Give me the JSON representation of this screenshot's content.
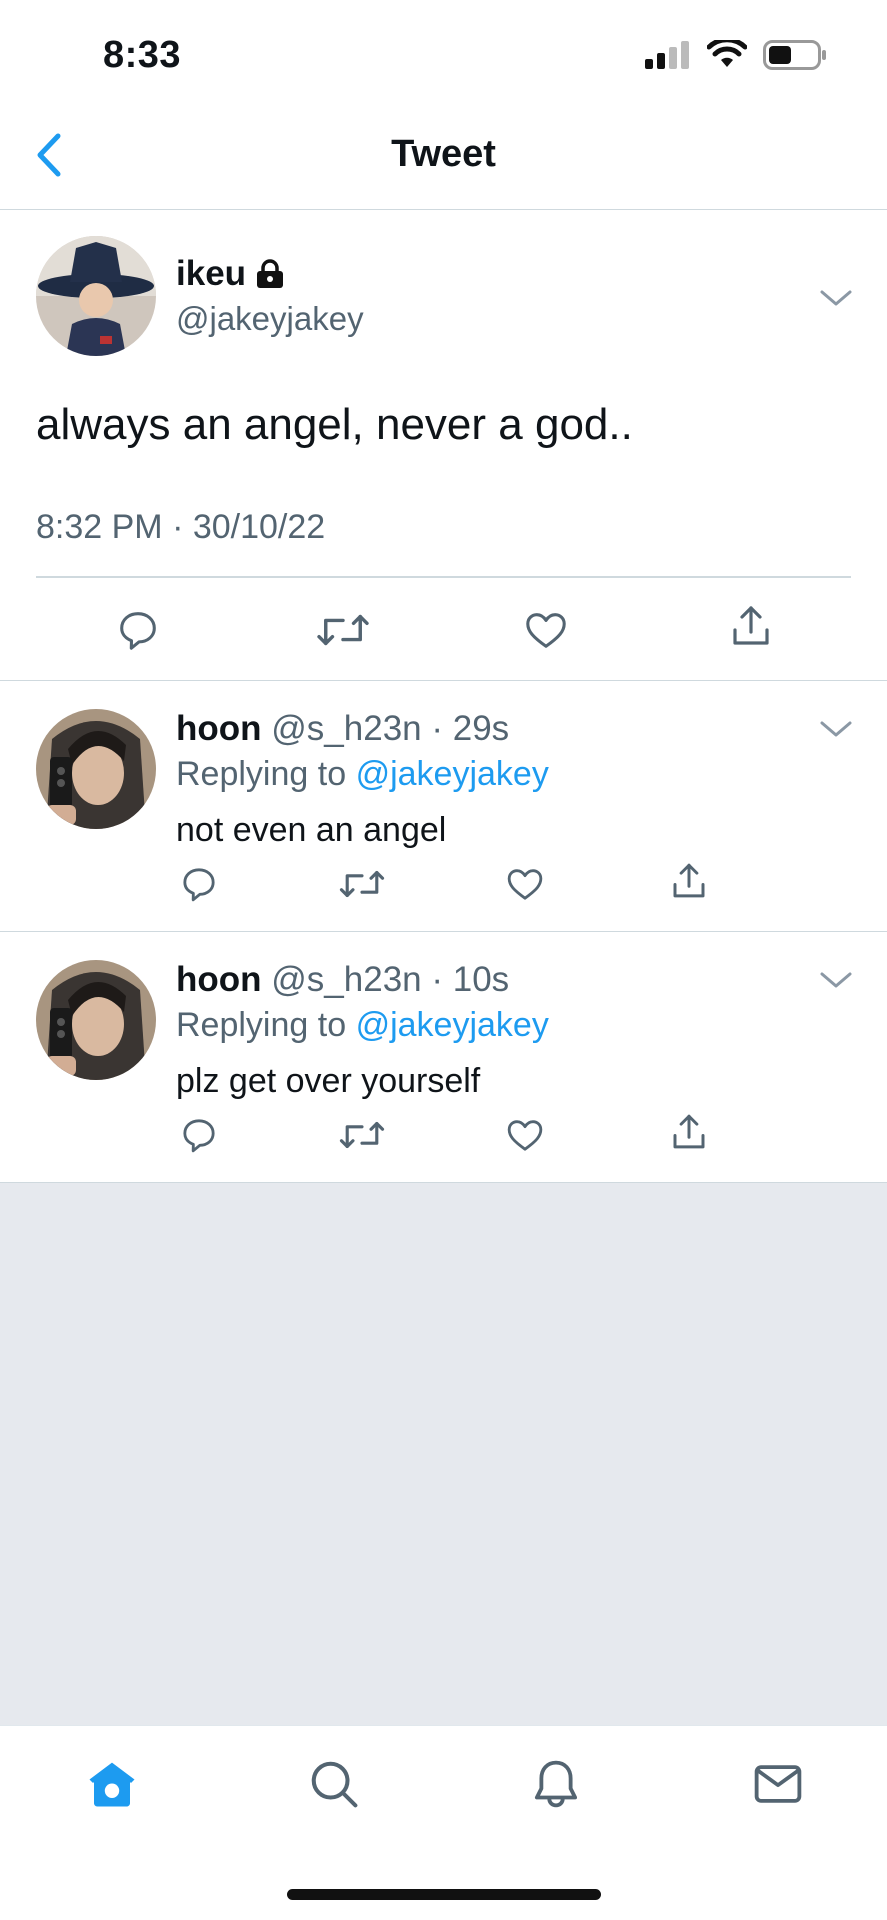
{
  "status_bar": {
    "time": "8:33"
  },
  "header": {
    "title": "Tweet"
  },
  "main_tweet": {
    "display_name": "ikeu",
    "handle": "@jakeyjakey",
    "text": "always an angel, never a god..",
    "timestamp": "8:32 PM · 30/10/22"
  },
  "replies": [
    {
      "display_name": "hoon",
      "handle": "@s_h23n",
      "time": "· 29s",
      "replying_label": "Replying to",
      "replying_to": "@jakeyjakey",
      "text": "not even an angel"
    },
    {
      "display_name": "hoon",
      "handle": "@s_h23n",
      "time": "· 10s",
      "replying_label": "Replying to",
      "replying_to": "@jakeyjakey",
      "text": "plz get over yourself"
    }
  ],
  "colors": {
    "accent": "#1d9bf0",
    "secondary_text": "#536471",
    "empty_background": "#e6e9ee"
  },
  "icons": {
    "tab_bar": [
      "home-icon",
      "search-icon",
      "notifications-icon",
      "messages-icon"
    ],
    "tweet_actions": [
      "reply-icon",
      "retweet-icon",
      "like-icon",
      "share-icon"
    ]
  }
}
